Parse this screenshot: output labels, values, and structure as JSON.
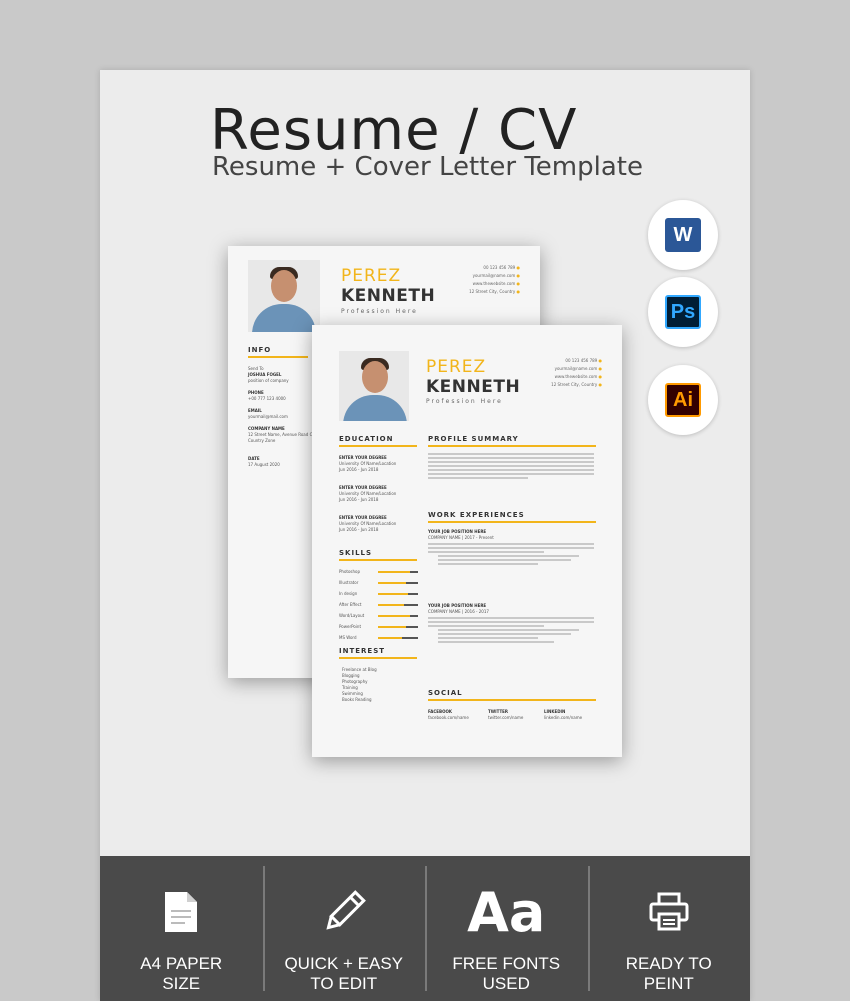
{
  "header": {
    "title": "Resume / CV",
    "subtitle": "Resume + Cover Letter Template"
  },
  "app_icons": [
    {
      "name": "word-icon",
      "letter": "W",
      "color": "#2b5797"
    },
    {
      "name": "photoshop-icon",
      "letter": "Ps",
      "color": "#31a8ff"
    },
    {
      "name": "illustrator-icon",
      "letter": "Ai",
      "color": "#ff9a00"
    }
  ],
  "resume": {
    "first_name": "PEREZ",
    "last_name": "KENNETH",
    "profession": "Profession Here",
    "contact": [
      "00 123 456 789",
      "yourmail@name.com",
      "www.thewebsite.com",
      "12 Street City, Country"
    ],
    "back_sections": {
      "info": "INFO",
      "send_to": "Send To",
      "send_name": "JOSHUA FOGEL",
      "send_position": "position of company",
      "phone_label": "PHONE",
      "phone_value": "+00 777 123 4000",
      "email_label": "EMAIL",
      "email_value": "yourmail@mail.com",
      "company_label": "COMPANY NAME",
      "company_value": "12 Street Name, Avenue Road City Country Zone",
      "date_label": "DATE",
      "date_value": "17 August 2020"
    },
    "sections": {
      "education": "EDUCATION",
      "skills": "SKILLS",
      "interest": "INTEREST",
      "profile": "PROFILE SUMMARY",
      "work": "WORK EXPERIENCES",
      "social": "SOCIAL"
    },
    "education_items": [
      {
        "degree": "ENTER YOUR DEGREE",
        "school": "University Of Name/Location",
        "years": "Jun 2016 - Jun 2018"
      },
      {
        "degree": "ENTER YOUR DEGREE",
        "school": "University Of Name/Location",
        "years": "Jun 2016 - Jun 2018"
      },
      {
        "degree": "ENTER YOUR DEGREE",
        "school": "University Of Name/Location",
        "years": "Jun 2016 - Jun 2018"
      }
    ],
    "skills": [
      "Photoshop",
      "Illustrator",
      "In design",
      "After Effect",
      "Word/Layout",
      "PowerPoint",
      "MS Word"
    ],
    "interests": [
      "Freelance at Blog",
      "Blogging",
      "Photography",
      "Training",
      "Swimming",
      "Books Reading"
    ],
    "jobs": [
      {
        "title": "YOUR JOB POSITION HERE",
        "company": "COMPANY NAME | 2017 - Present"
      },
      {
        "title": "YOUR JOB POSITION HERE",
        "company": "COMPANY NAME | 2016 - 2017"
      }
    ],
    "social": [
      {
        "label": "FACEBOOK",
        "value": "facebook.com/name"
      },
      {
        "label": "TWITTER",
        "value": "twitter.com/name"
      },
      {
        "label": "LINKEDIN",
        "value": "linkedin.com/name"
      }
    ]
  },
  "features": [
    {
      "icon": "document-icon",
      "label": "A4 PAPER\nSIZE"
    },
    {
      "icon": "pencil-icon",
      "label": "QUICK + EASY\nTO EDIT"
    },
    {
      "icon": "font-icon",
      "glyph": "Aa",
      "label": "FREE FONTS\nUSED"
    },
    {
      "icon": "printer-icon",
      "label": "READY TO\nPEINT"
    }
  ],
  "colors": {
    "accent": "#f2b51b",
    "bar": "#4a4a4a",
    "background": "#c9c9c9"
  }
}
